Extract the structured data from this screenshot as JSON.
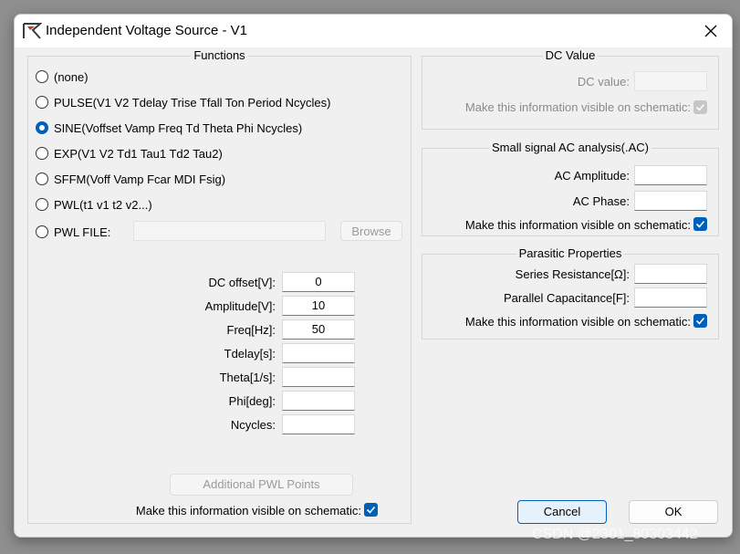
{
  "window": {
    "title": "Independent Voltage Source - V1"
  },
  "functions": {
    "title": "Functions",
    "options": [
      "(none)",
      "PULSE(V1 V2 Tdelay Trise Tfall Ton Period Ncycles)",
      "SINE(Voffset Vamp Freq Td Theta Phi Ncycles)",
      "EXP(V1 V2 Td1 Tau1 Td2 Tau2)",
      "SFFM(Voff Vamp Fcar MDI Fsig)",
      "PWL(t1 v1 t2 v2...)",
      "PWL FILE:"
    ],
    "selected": "SINE(Voffset Vamp Freq Td Theta Phi Ncycles)",
    "pwl_file_value": "",
    "browse_label": "Browse",
    "params": [
      {
        "label": "DC offset[V]:",
        "value": "0"
      },
      {
        "label": "Amplitude[V]:",
        "value": "10"
      },
      {
        "label": "Freq[Hz]:",
        "value": "50"
      },
      {
        "label": "Tdelay[s]:",
        "value": ""
      },
      {
        "label": "Theta[1/s]:",
        "value": ""
      },
      {
        "label": "Phi[deg]:",
        "value": ""
      },
      {
        "label": "Ncycles:",
        "value": ""
      }
    ],
    "additional_pwl_label": "Additional PWL Points",
    "visible_label": "Make this information visible on schematic:",
    "visible_checked": true
  },
  "dc_value": {
    "title": "DC Value",
    "label": "DC value:",
    "value": "",
    "visible_label": "Make this information visible on schematic:",
    "visible_checked": true
  },
  "ac_analysis": {
    "title": "Small signal AC analysis(.AC)",
    "amplitude_label": "AC Amplitude:",
    "amplitude_value": "",
    "phase_label": "AC Phase:",
    "phase_value": "",
    "visible_label": "Make this information visible on schematic:",
    "visible_checked": true
  },
  "parasitic": {
    "title": "Parasitic Properties",
    "series_label": "Series Resistance[Ω]:",
    "series_value": "",
    "parallel_label": "Parallel Capacitance[F]:",
    "parallel_value": "",
    "visible_label": "Make this information visible on schematic:",
    "visible_checked": true
  },
  "buttons": {
    "cancel": "Cancel",
    "ok": "OK"
  },
  "watermark": "CSDN @2301_80303442",
  "colors": {
    "accent": "#005fb8",
    "dialog_bg": "#f0f0f0",
    "titlebar_bg": "#ffffff"
  }
}
